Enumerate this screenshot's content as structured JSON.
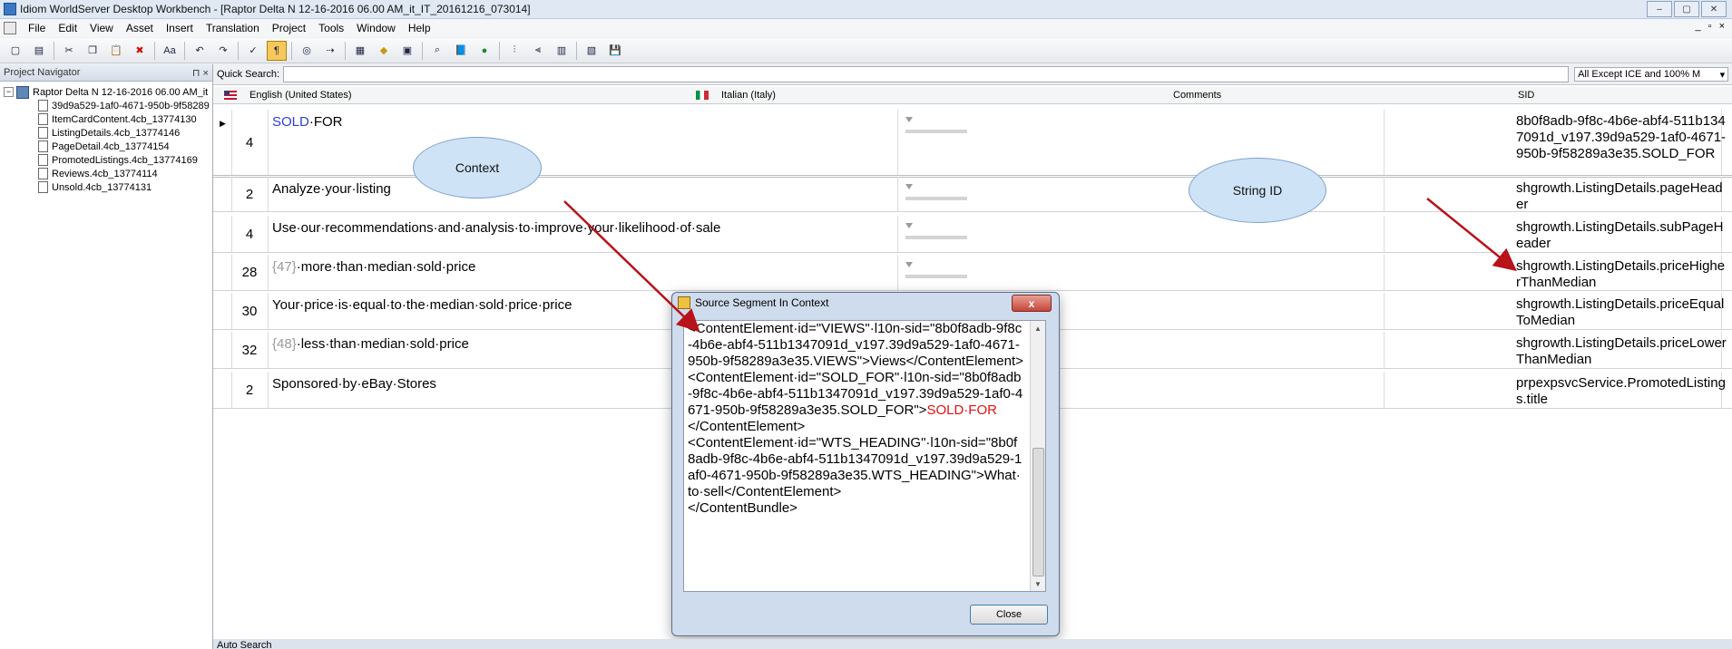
{
  "window": {
    "title": "Idiom WorldServer Desktop Workbench - [Raptor Delta N 12-16-2016 06.00 AM_it_IT_20161216_073014]",
    "controls": [
      "–",
      "▢",
      "✕"
    ]
  },
  "menu": {
    "items": [
      "File",
      "Edit",
      "View",
      "Asset",
      "Insert",
      "Translation",
      "Project",
      "Tools",
      "Window",
      "Help"
    ],
    "right_controls": [
      "_",
      "▫",
      "×"
    ]
  },
  "toolbar": {
    "icons": [
      "new-icon",
      "open-icon",
      "cut-icon",
      "copy-icon",
      "paste-icon",
      "delete-icon",
      "font-icon",
      "undo-icon",
      "redo-icon",
      "spellcheck-icon",
      "pilcrow-icon",
      "view-icon",
      "next-icon",
      "grid-icon",
      "diamond-icon",
      "tm-icon",
      "lookup-icon",
      "glossary-icon",
      "record-icon",
      "merge-icon",
      "split-icon",
      "export-icon",
      "import-icon",
      "save-icon"
    ],
    "glyphs": [
      "▢",
      "▤",
      "✂",
      "❐",
      "📋",
      "✖",
      "Aa",
      "↶",
      "↷",
      "✓",
      "¶",
      "◎",
      "⇢",
      "▦",
      "◆",
      "▣",
      "⌕",
      "📘",
      "●",
      "⫶",
      "⫷",
      "▥",
      "▧",
      "💾"
    ]
  },
  "navigator": {
    "title": "Project Navigator",
    "pin": "⊓ ×",
    "root": "Raptor Delta N 12-16-2016 06.00 AM_it",
    "files": [
      "39d9a529-1af0-4671-950b-9f58289",
      "ItemCardContent.4cb_13774130",
      "ListingDetails.4cb_13774146",
      "PageDetail.4cb_13774154",
      "PromotedListings.4cb_13774169",
      "Reviews.4cb_13774114",
      "Unsold.4cb_13774131"
    ]
  },
  "quick_search": {
    "label": "Quick Search:",
    "value": "",
    "filter": "All Except ICE and 100% M"
  },
  "columns": {
    "source": "English (United States)",
    "target": "Italian (Italy)",
    "comments": "Comments",
    "sid": "SID"
  },
  "rows": [
    {
      "num": "4",
      "src_pre": "",
      "src_hl": "SOLD",
      "src_post": "·FOR",
      "sid": "8b0f8adb-9f8c-4b6e-abf4-511b1347091d_v197.39d9a529-1af0-4671-950b-9f58289a3e35.SOLD_FOR"
    },
    {
      "num": "2",
      "src_pre": "Analyze·your·listing",
      "src_hl": "",
      "src_post": "",
      "sid": "shgrowth.ListingDetails.pageHeader"
    },
    {
      "num": "4",
      "src_pre": "Use·our·recommendations·and·analysis·to·improve·your·likelihood·of·sale",
      "src_hl": "",
      "src_post": "",
      "sid": "shgrowth.ListingDetails.subPageHeader"
    },
    {
      "num": "28",
      "src_pre": "",
      "src_hl": "{47}",
      "src_post": "·more·than·median·sold·price",
      "sid": "shgrowth.ListingDetails.priceHigherThanMedian"
    },
    {
      "num": "30",
      "src_pre": "Your·price·is·equal·to·the·median·sold·price·price",
      "src_hl": "",
      "src_post": "",
      "sid": "shgrowth.ListingDetails.priceEqualToMedian"
    },
    {
      "num": "32",
      "src_pre": "",
      "src_hl": "{48}",
      "src_post": "·less·than·median·sold·price",
      "sid": "shgrowth.ListingDetails.priceLowerThanMedian"
    },
    {
      "num": "2",
      "src_pre": "Sponsored·by·eBay·Stores",
      "src_hl": "",
      "src_post": "",
      "sid": "prpexpsvcService.PromotedListings.title"
    }
  ],
  "callouts": {
    "context": "Context",
    "string_id": "String ID"
  },
  "dialog": {
    "title": "Source Segment In Context",
    "close_x": "x",
    "text_before": "<ContentElement·id=\"VIEWS\"·l10n-sid=\"8b0f8adb-9f8c-4b6e-abf4-511b1347091d_v197.39d9a529-1af0-4671-950b-9f58289a3e35.VIEWS\">Views</ContentElement>\n<ContentElement·id=\"SOLD_FOR\"·l10n-sid=\"8b0f8adb-9f8c-4b6e-abf4-511b1347091d_v197.39d9a529-1af0-4671-950b-9f58289a3e35.SOLD_FOR\">",
    "text_highlight": "SOLD·FOR",
    "text_after": "\n</ContentElement>\n<ContentElement·id=\"WTS_HEADING\"·l10n-sid=\"8b0f8adb-9f8c-4b6e-abf4-511b1347091d_v197.39d9a529-1af0-4671-950b-9f58289a3e35.WTS_HEADING\">What·to·sell</ContentElement>\n</ContentBundle>",
    "close_button": "Close"
  },
  "auto_search": "Auto Search",
  "colors": {
    "highlight_blue": "#2c3fd6",
    "highlight_red": "#e01010",
    "arrow": "#b8121a"
  }
}
